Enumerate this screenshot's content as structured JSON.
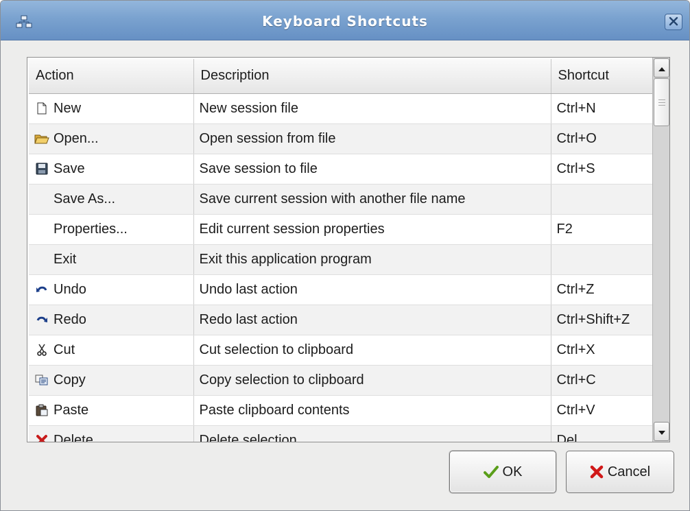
{
  "window": {
    "title": "Keyboard Shortcuts"
  },
  "table": {
    "headers": [
      "Action",
      "Description",
      "Shortcut"
    ],
    "rows": [
      {
        "action": "New",
        "icon": "new-file-icon",
        "description": "New session file",
        "shortcut": "Ctrl+N"
      },
      {
        "action": "Open...",
        "icon": "open-folder-icon",
        "description": "Open session from file",
        "shortcut": "Ctrl+O"
      },
      {
        "action": "Save",
        "icon": "save-disk-icon",
        "description": "Save session to file",
        "shortcut": "Ctrl+S"
      },
      {
        "action": "Save As...",
        "icon": "",
        "description": "Save current session with another file name",
        "shortcut": ""
      },
      {
        "action": "Properties...",
        "icon": "",
        "description": "Edit current session properties",
        "shortcut": "F2"
      },
      {
        "action": "Exit",
        "icon": "",
        "description": "Exit this application program",
        "shortcut": ""
      },
      {
        "action": "Undo",
        "icon": "undo-icon",
        "description": "Undo last action",
        "shortcut": "Ctrl+Z"
      },
      {
        "action": "Redo",
        "icon": "redo-icon",
        "description": "Redo last action",
        "shortcut": "Ctrl+Shift+Z"
      },
      {
        "action": "Cut",
        "icon": "scissors-icon",
        "description": "Cut selection to clipboard",
        "shortcut": "Ctrl+X"
      },
      {
        "action": "Copy",
        "icon": "copy-icon",
        "description": "Copy selection to clipboard",
        "shortcut": "Ctrl+C"
      },
      {
        "action": "Paste",
        "icon": "paste-icon",
        "description": "Paste clipboard contents",
        "shortcut": "Ctrl+V"
      },
      {
        "action": "Delete",
        "icon": "delete-icon",
        "description": "Delete selection",
        "shortcut": "Del"
      }
    ]
  },
  "buttons": {
    "ok_label": "OK",
    "cancel_label": "Cancel"
  },
  "colors": {
    "titlebar": "#7aa2cf",
    "ok_check": "#5a9e1a",
    "cancel_x": "#d01818"
  }
}
